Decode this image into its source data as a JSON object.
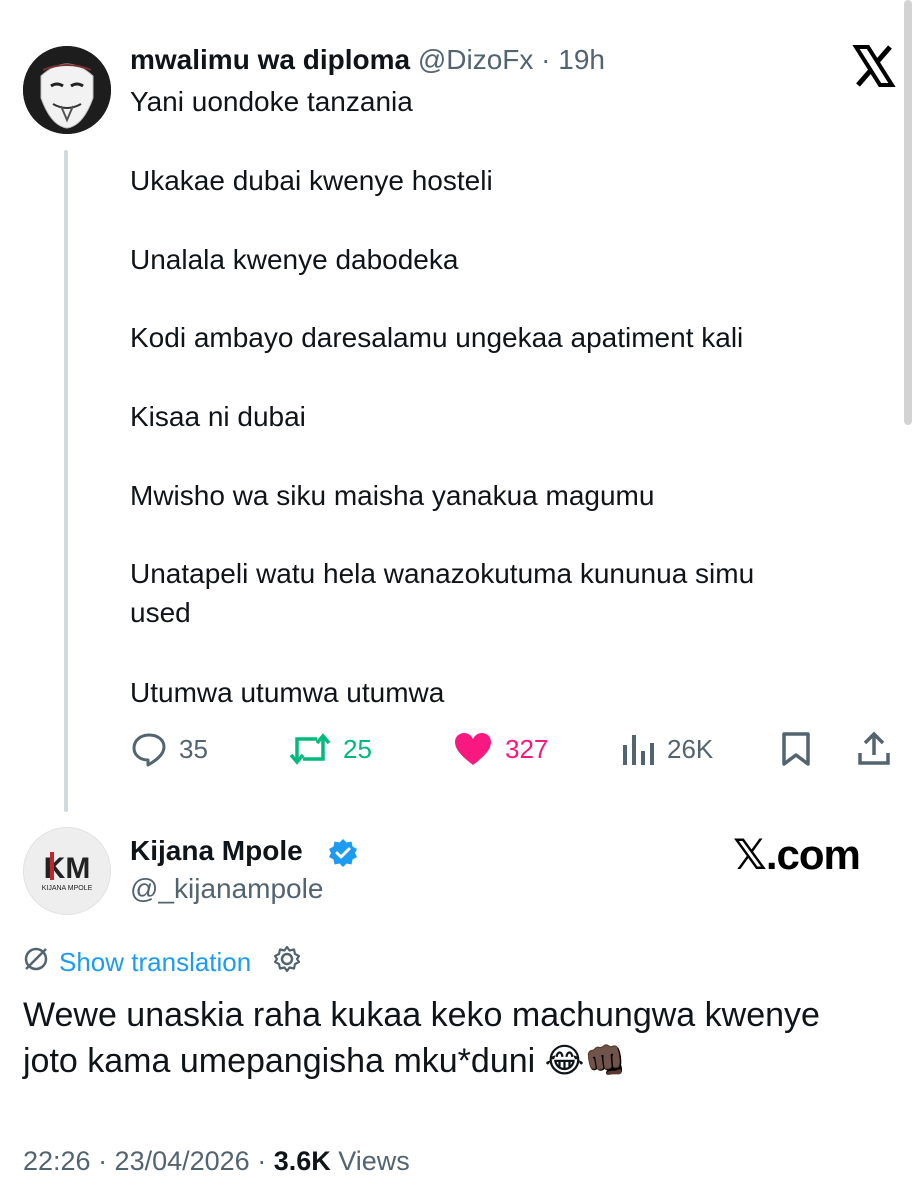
{
  "original_tweet": {
    "display_name": "mwalimu wa diploma",
    "handle": "@DizoFx",
    "separator": "·",
    "time": "19h",
    "lines": [
      "Yani uondoke tanzania",
      "Ukakae dubai  kwenye hosteli",
      "Unalala kwenye dabodeka",
      "Kodi ambayo daresalamu ungekaa apatiment kali",
      "Kisaa ni dubai",
      "Mwisho wa siku maisha yanakua magumu",
      "Unatapeli watu hela wanazokutuma kununua simu",
      "used",
      "Utumwa utumwa utumwa"
    ],
    "metrics": {
      "replies": "35",
      "reposts": "25",
      "likes": "327",
      "views": "26K"
    }
  },
  "reply_tweet": {
    "display_name": "Kijana Mpole",
    "handle": "@_kijanampole",
    "avatar_text": "KM",
    "avatar_subtext": "KIJANA MPOLE",
    "show_translation": "Show translation",
    "body_line1": "Wewe unaskia raha kukaa keko machungwa kwenye",
    "body_line2": "joto kama umepangisha mku*duni",
    "emojis": "😂👊🏿",
    "timestamp": "22:26 · 23/04/2026 · ",
    "view_count": "3.6K",
    "views_label": " Views"
  },
  "watermark": "𝕏.com",
  "colors": {
    "text": "#0f1419",
    "muted": "#536471",
    "link": "#1d9bf0",
    "repost": "#00ba7c",
    "like": "#f91880"
  }
}
